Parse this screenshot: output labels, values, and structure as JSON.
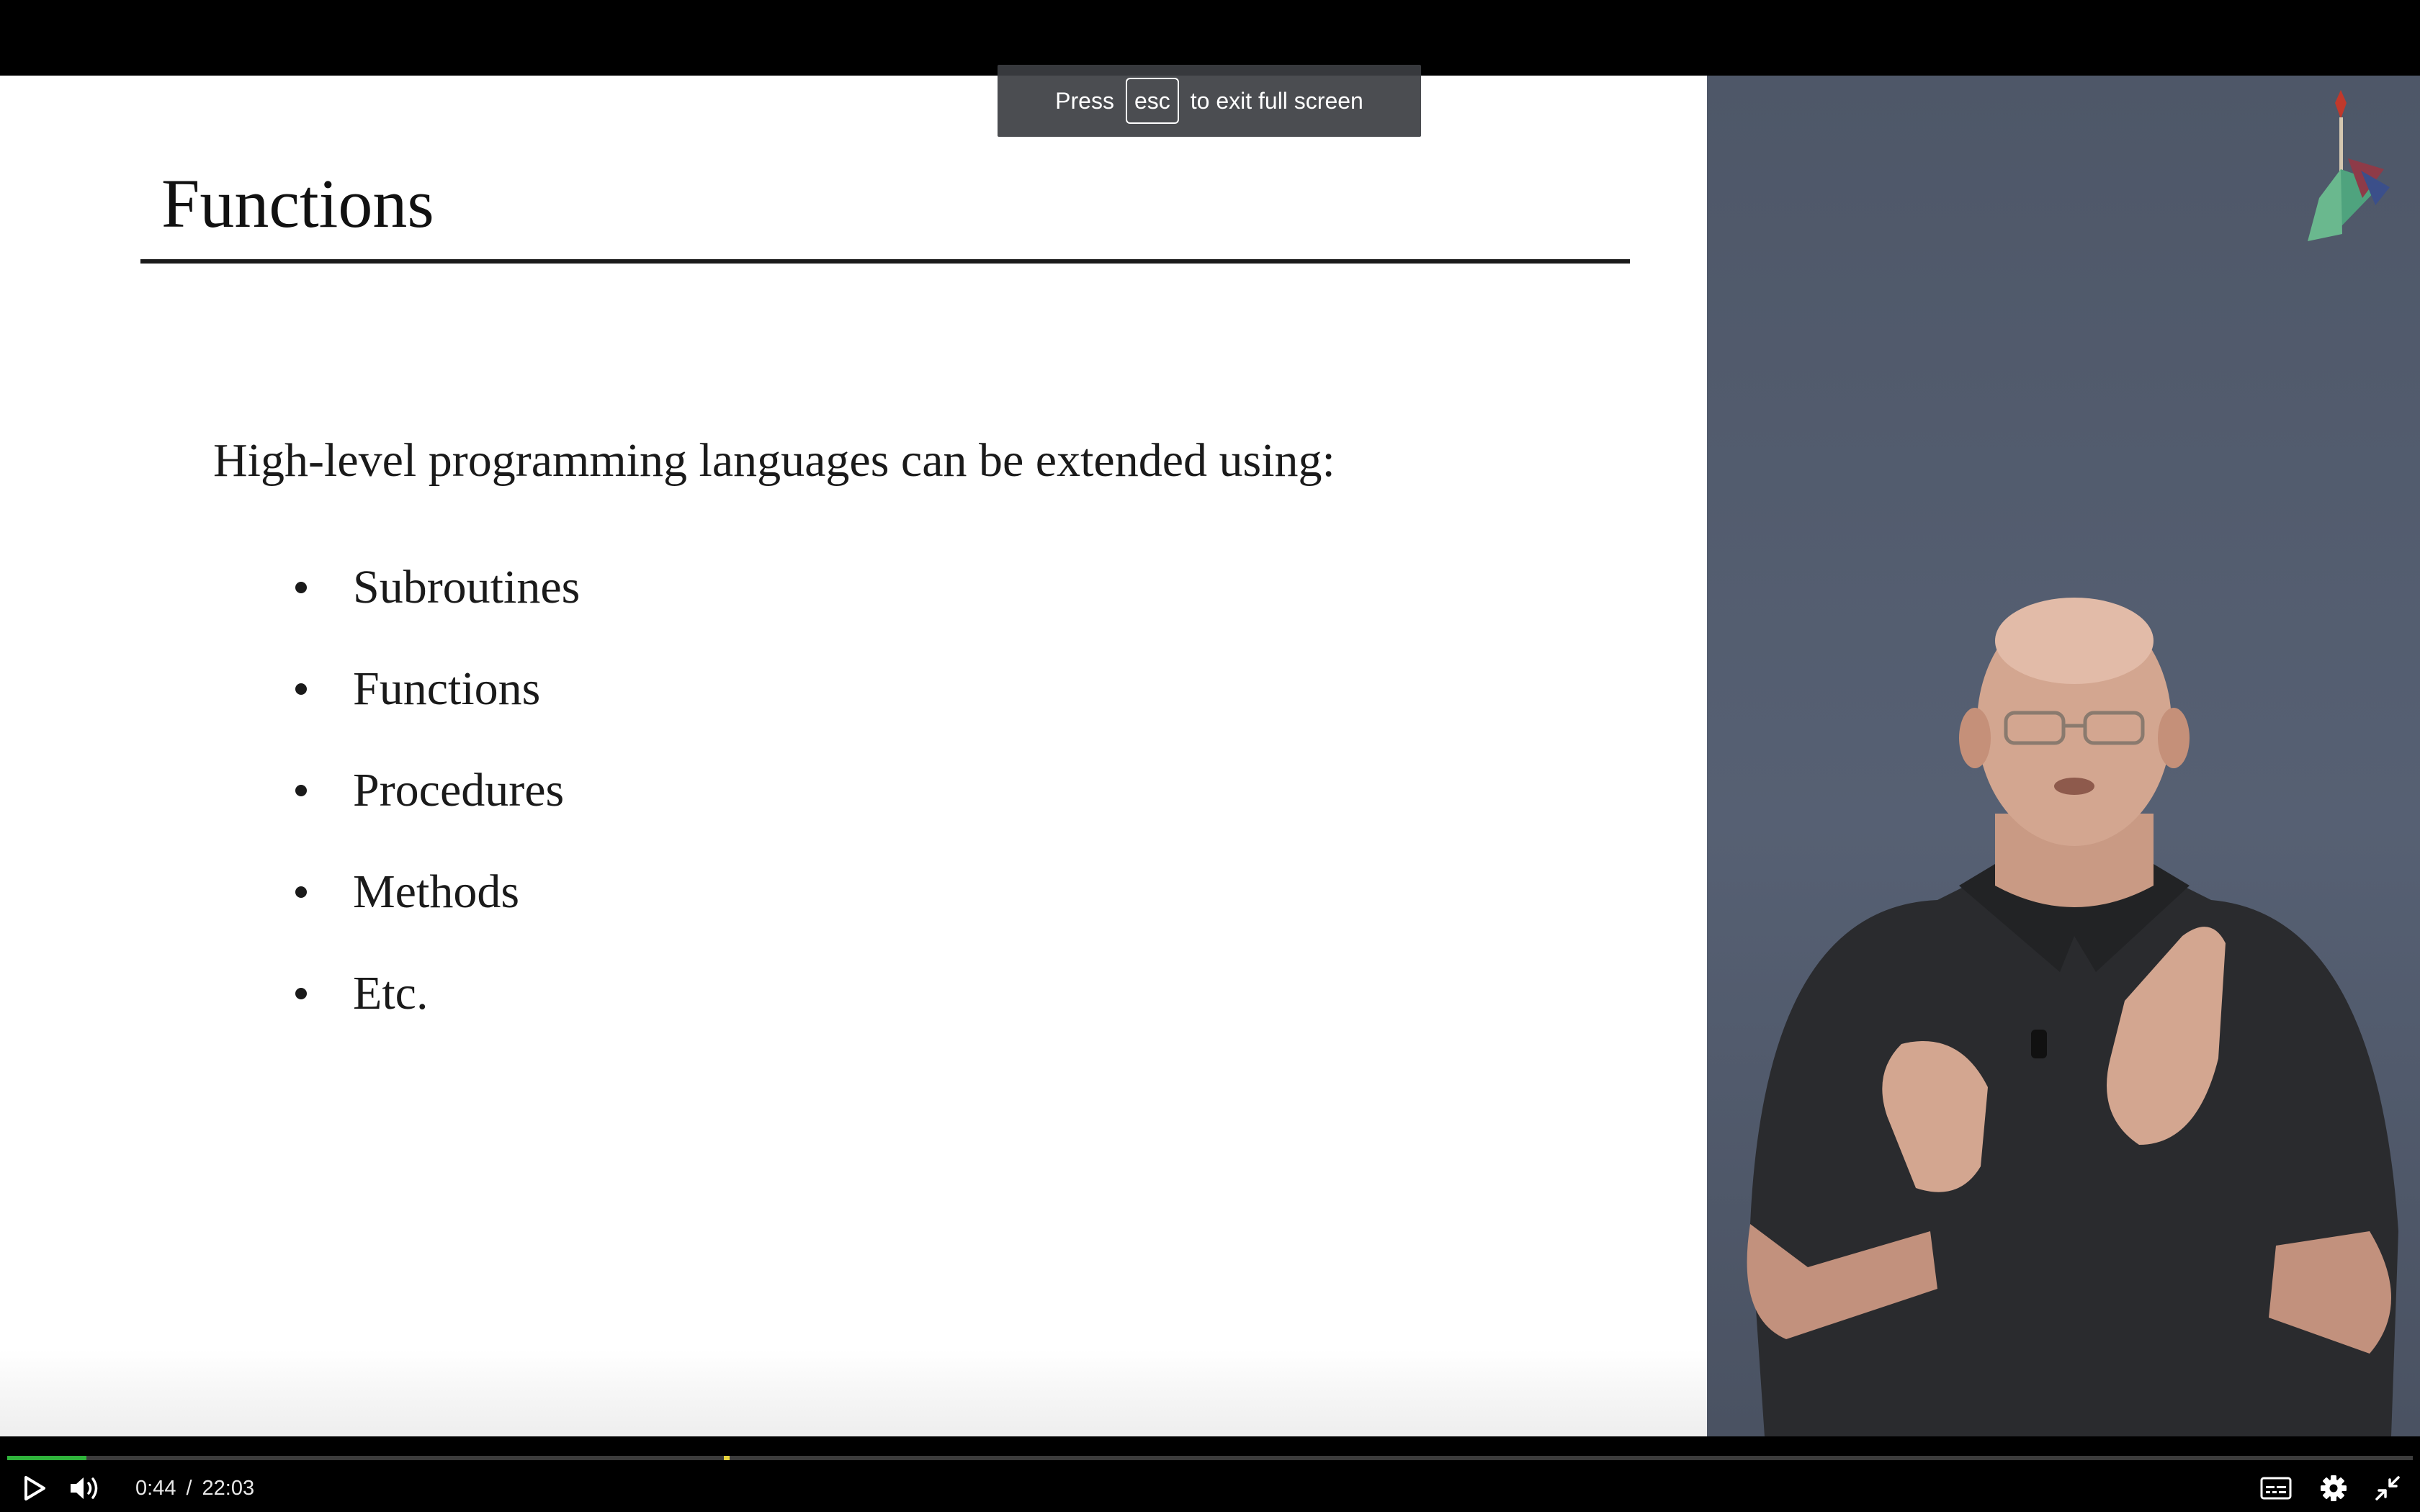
{
  "toast": {
    "prefix": "Press",
    "key": "esc",
    "suffix": "to exit full screen"
  },
  "slide": {
    "title": "Functions",
    "intro": "High-level programming languages can be extended using:",
    "bullets": [
      "Subroutines",
      "Functions",
      "Procedures",
      "Methods",
      "Etc."
    ]
  },
  "player": {
    "current_time": "0:44",
    "separator": "/",
    "duration": "22:03",
    "progress_fraction": 0.033,
    "chapter_marker_fraction": 0.298,
    "icons": {
      "play": "play-icon",
      "volume": "volume-icon",
      "captions": "captions-icon",
      "settings": "gear-icon",
      "exit_fullscreen": "exit-fullscreen-icon"
    },
    "colors": {
      "played": "#2fb33b",
      "marker": "#e6d23c",
      "track": "#3c3c3c"
    }
  }
}
